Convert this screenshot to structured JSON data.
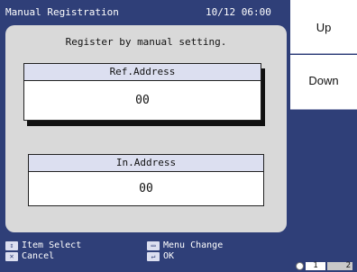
{
  "title_bar": {
    "title": "Manual Registration",
    "datetime": "10/12 06:00"
  },
  "main": {
    "subtitle": "Register by manual setting.",
    "ref_address": {
      "label": "Ref.Address",
      "value": "00"
    },
    "in_address": {
      "label": "In.Address",
      "value": "00"
    }
  },
  "side_buttons": {
    "up": "Up",
    "down": "Down"
  },
  "footer": {
    "item_select_icon": "up-down-arrow-icon",
    "item_select": "Item Select",
    "cancel_icon": "cancel-icon",
    "cancel": "Cancel",
    "menu_change_icon": "menu-change-icon",
    "menu_change": "Menu Change",
    "ok_icon": "enter-icon",
    "ok": "OK"
  },
  "pager": {
    "page1": "1",
    "page2": "2"
  }
}
